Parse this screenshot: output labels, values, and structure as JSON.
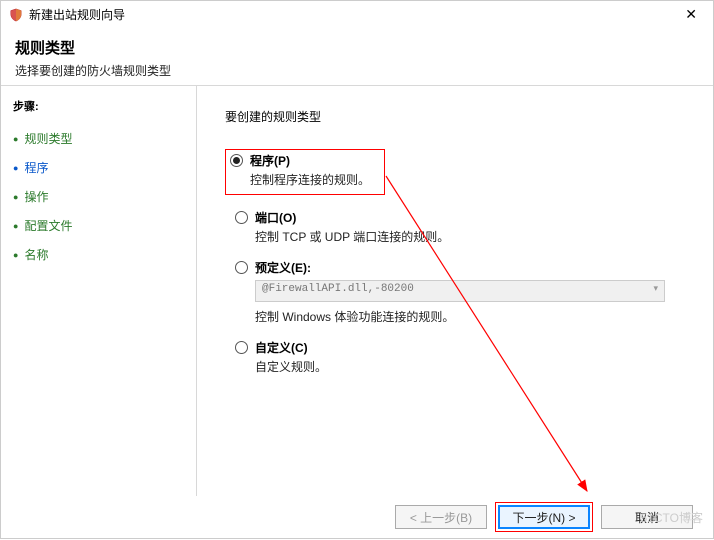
{
  "titlebar": {
    "title": "新建出站规则向导"
  },
  "header": {
    "title": "规则类型",
    "subtitle": "选择要创建的防火墙规则类型"
  },
  "sidebar": {
    "steps_label": "步骤:",
    "items": [
      {
        "label": "规则类型"
      },
      {
        "label": "程序"
      },
      {
        "label": "操作"
      },
      {
        "label": "配置文件"
      },
      {
        "label": "名称"
      }
    ]
  },
  "content": {
    "question": "要创建的规则类型",
    "options": [
      {
        "id": "program",
        "title": "程序(P)",
        "desc": "控制程序连接的规则。",
        "checked": true
      },
      {
        "id": "port",
        "title": "端口(O)",
        "desc": "控制 TCP 或 UDP 端口连接的规则。",
        "checked": false
      },
      {
        "id": "predefined",
        "title": "预定义(E):",
        "desc": "控制 Windows 体验功能连接的规则。",
        "checked": false,
        "combo": "@FirewallAPI.dll,-80200"
      },
      {
        "id": "custom",
        "title": "自定义(C)",
        "desc": "自定义规则。",
        "checked": false
      }
    ]
  },
  "footer": {
    "back": "< 上一步(B)",
    "next": "下一步(N) >",
    "cancel": "取消"
  },
  "watermark": "51CTO博客"
}
